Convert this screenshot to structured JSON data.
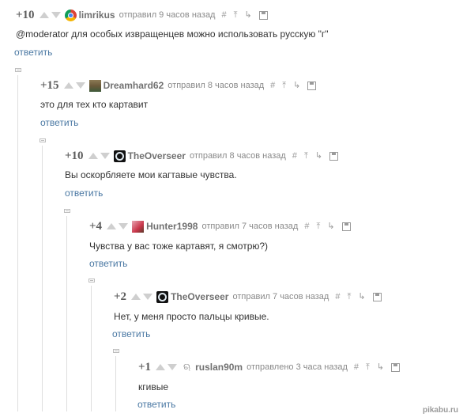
{
  "comments": [
    {
      "rating": "+10",
      "username": "limrikus",
      "avatar_icon": "chrome-logo-avatar",
      "meta": "отправил 9 часов назад",
      "text": "@moderator для особых извращенцев можно использовать русскую \"г\"",
      "reply": "ответить"
    },
    {
      "rating": "+15",
      "username": "Dreamhard62",
      "avatar_icon": "landscape-avatar",
      "meta": "отправил 8 часов назад",
      "text": "это для тех кто картавит",
      "reply": "ответить"
    },
    {
      "rating": "+10",
      "username": "TheOverseer",
      "avatar_icon": "dark-circle-avatar",
      "meta": "отправил 8 часов назад",
      "text": "Вы оскорбляете мои кагтавые чувства.",
      "reply": "ответить"
    },
    {
      "rating": "+4",
      "username": "Hunter1998",
      "avatar_icon": "anime-avatar",
      "meta": "отправил 7 часов назад",
      "text": "Чувства у вас тоже картавят, я смотрю?)",
      "reply": "ответить"
    },
    {
      "rating": "+2",
      "username": "TheOverseer",
      "avatar_icon": "dark-circle-avatar",
      "meta": "отправил 7 часов назад",
      "text": "Нет, у меня просто пальцы кривые.",
      "reply": "ответить"
    },
    {
      "rating": "+1",
      "username": "ruslan90m",
      "avatar_icon": "headphones-avatar",
      "meta": "отправлено 3 часа назад",
      "text": "кгивые",
      "reply": "ответить"
    }
  ],
  "action_icons": [
    "hash-icon",
    "pin-up-icon",
    "reply-arrow-icon",
    "save-icon"
  ],
  "watermark": "pikabu.ru",
  "colors": {
    "link": "#4a78a3",
    "rating": "#5d5d5d",
    "meta": "#8a8a8a",
    "arrow": "#cfcfcf"
  }
}
